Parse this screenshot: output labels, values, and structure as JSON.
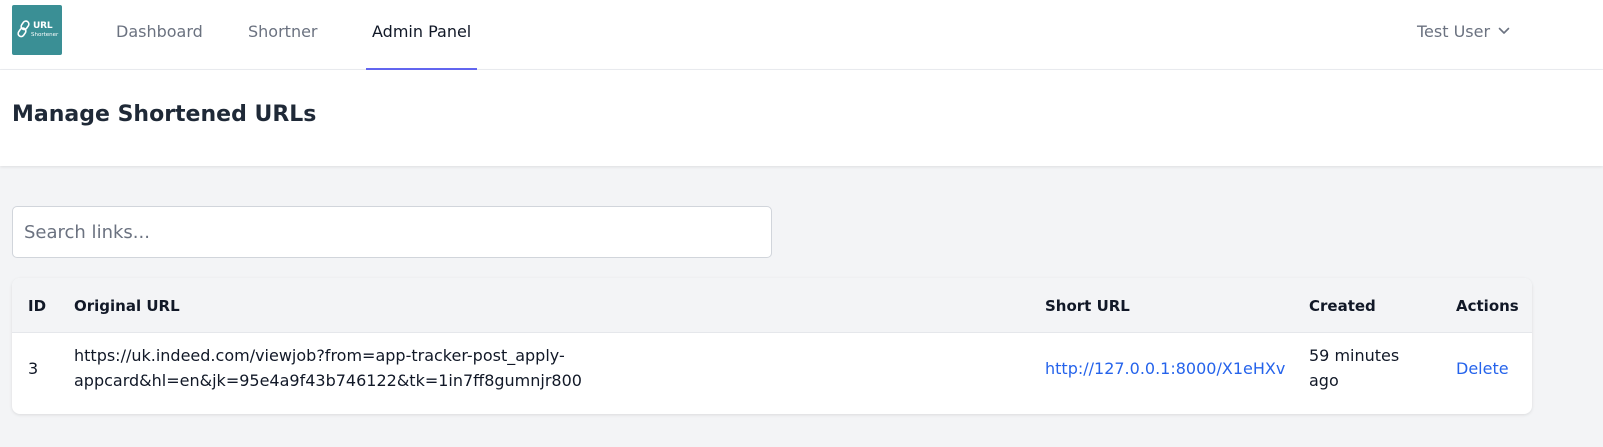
{
  "app": {
    "logo_title": "URL",
    "logo_subtitle": "Shortener"
  },
  "nav": {
    "dashboard": "Dashboard",
    "shortener": "Shortner",
    "admin_panel": "Admin Panel",
    "active": "Admin Panel"
  },
  "user": {
    "name": "Test User"
  },
  "page": {
    "title": "Manage Shortened URLs"
  },
  "search": {
    "placeholder": "Search links...",
    "value": ""
  },
  "table": {
    "headers": {
      "id": "ID",
      "original_url": "Original URL",
      "short_url": "Short URL",
      "created": "Created",
      "actions": "Actions"
    },
    "rows": [
      {
        "id": "3",
        "original_url": "https://uk.indeed.com/viewjob?from=app-tracker-post_apply-appcard&hl=en&jk=95e4a9f43b746122&tk=1in7ff8gumnjr800",
        "original_url_line1": "https://uk.indeed.com/viewjob?from=app-tracker-post_apply-",
        "original_url_line2": "appcard&hl=en&jk=95e4a9f43b746122&tk=1in7ff8gumnjr800",
        "short_url": "http://127.0.0.1:8000/X1eHXv",
        "created_line1": "59 minutes",
        "created_line2": "ago",
        "action": "Delete"
      }
    ]
  },
  "colors": {
    "logo_bg": "#3a8f95",
    "active_underline": "#6366f1",
    "link": "#2563eb",
    "delete": "#dc2626",
    "page_bg": "#f3f4f6"
  },
  "icons": {
    "logo": "link-icon",
    "user_menu": "chevron-down-icon"
  }
}
